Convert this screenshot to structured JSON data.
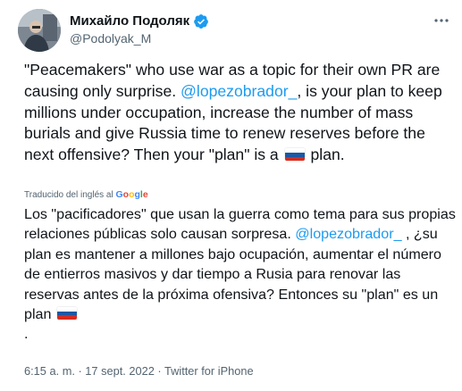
{
  "author": {
    "name": "Михайло Подоляк",
    "handle": "@Podolyak_M",
    "verified": true
  },
  "more_icon": "more-horizontal-icon",
  "tweet": {
    "en_part1": "\"Peacemakers\" who use war as a topic for their own PR are causing only surprise. ",
    "en_mention": "@lopezobrador_",
    "en_part2": ", is your plan to keep millions under occupation, increase the number of mass burials and give Russia time to renew reserves before the next offensive? Then your \"plan\" is a ",
    "en_part3": " plan.",
    "translation_label": "Traducido del inglés al ",
    "translation_brand": "Google",
    "es_part1": "Los \"pacificadores\" que usan la guerra como tema para sus propias relaciones públicas solo causan sorpresa. ",
    "es_mention": "@lopezobrador_",
    "es_part2": " , ¿su plan es mantener a millones bajo ocupación, aumentar el número de entierros masivos y dar tiempo a Rusia para renovar las reservas antes de la próxima ofensiva? Entonces su \"plan\" es un plan ",
    "es_part3": ".",
    "flag_colors": [
      "#ffffff",
      "#1c57a5",
      "#d52b1e"
    ]
  },
  "meta": {
    "time": "6:15 a. m.",
    "sep1": " · ",
    "date": "17 sept. 2022",
    "sep2": " · ",
    "source": "Twitter for iPhone"
  }
}
